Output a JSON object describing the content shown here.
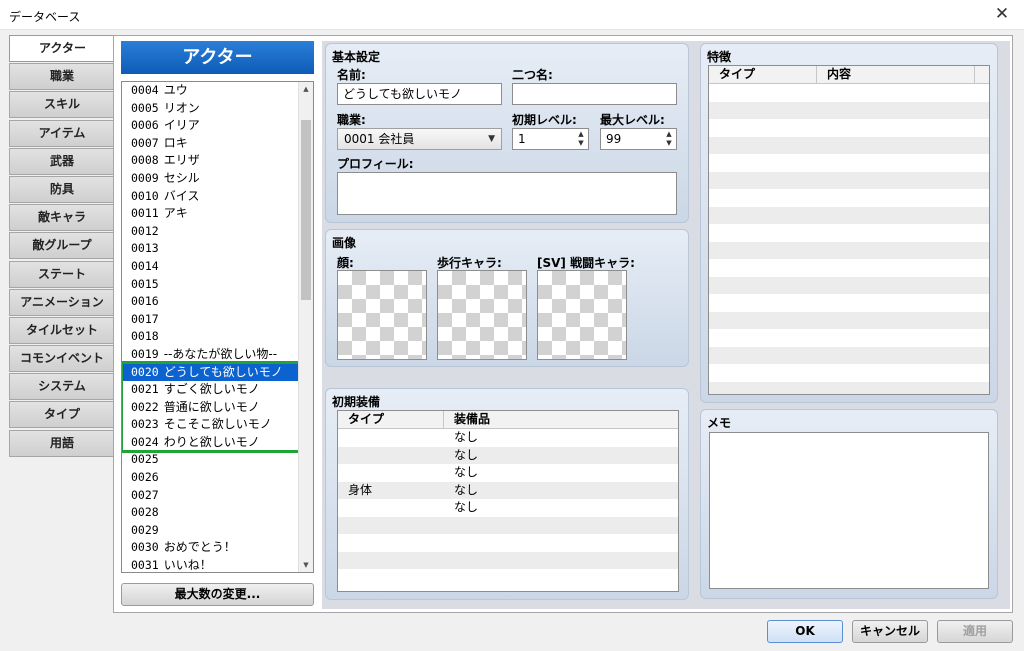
{
  "window": {
    "title": "データベース",
    "close_glyph": "✕"
  },
  "tabs": [
    {
      "label": "アクター",
      "active": true
    },
    {
      "label": "職業"
    },
    {
      "label": "スキル"
    },
    {
      "label": "アイテム"
    },
    {
      "label": "武器"
    },
    {
      "label": "防具"
    },
    {
      "label": "敵キャラ"
    },
    {
      "label": "敵グループ"
    },
    {
      "label": "ステート"
    },
    {
      "label": "アニメーション"
    },
    {
      "label": "タイルセット"
    },
    {
      "label": "コモンイベント"
    },
    {
      "label": "システム"
    },
    {
      "label": "タイプ"
    },
    {
      "label": "用語"
    }
  ],
  "actor_list": {
    "header": "アクター",
    "max_button": "最大数の変更...",
    "items": [
      {
        "num": "0004",
        "name": "ユウ"
      },
      {
        "num": "0005",
        "name": "リオン"
      },
      {
        "num": "0006",
        "name": "イリア"
      },
      {
        "num": "0007",
        "name": "ロキ"
      },
      {
        "num": "0008",
        "name": "エリザ"
      },
      {
        "num": "0009",
        "name": "セシル"
      },
      {
        "num": "0010",
        "name": "バイス"
      },
      {
        "num": "0011",
        "name": "アキ"
      },
      {
        "num": "0012",
        "name": ""
      },
      {
        "num": "0013",
        "name": ""
      },
      {
        "num": "0014",
        "name": ""
      },
      {
        "num": "0015",
        "name": ""
      },
      {
        "num": "0016",
        "name": ""
      },
      {
        "num": "0017",
        "name": ""
      },
      {
        "num": "0018",
        "name": ""
      },
      {
        "num": "0019",
        "name": "--あなたが欲しい物--"
      },
      {
        "num": "0020",
        "name": "どうしても欲しいモノ",
        "selected": true
      },
      {
        "num": "0021",
        "name": "すごく欲しいモノ"
      },
      {
        "num": "0022",
        "name": "普通に欲しいモノ"
      },
      {
        "num": "0023",
        "name": "そこそこ欲しいモノ"
      },
      {
        "num": "0024",
        "name": "わりと欲しいモノ"
      },
      {
        "num": "0025",
        "name": ""
      },
      {
        "num": "0026",
        "name": ""
      },
      {
        "num": "0027",
        "name": ""
      },
      {
        "num": "0028",
        "name": ""
      },
      {
        "num": "0029",
        "name": ""
      },
      {
        "num": "0030",
        "name": "おめでとう！"
      },
      {
        "num": "0031",
        "name": "いいね！"
      }
    ]
  },
  "basic": {
    "title": "基本設定",
    "name_label": "名前:",
    "name_value": "どうしても欲しいモノ",
    "nickname_label": "二つ名:",
    "nickname_value": "",
    "class_label": "職業:",
    "class_value": "0001 会社員",
    "init_level_label": "初期レベル:",
    "init_level_value": "1",
    "max_level_label": "最大レベル:",
    "max_level_value": "99",
    "profile_label": "プロフィール:",
    "profile_value": ""
  },
  "images": {
    "title": "画像",
    "face_label": "顔:",
    "walk_label": "歩行キャラ:",
    "battler_label": "[SV] 戦闘キャラ:"
  },
  "equipment": {
    "title": "初期装備",
    "col_type": "タイプ",
    "col_item": "装備品",
    "rows": [
      {
        "type": "",
        "item": "なし"
      },
      {
        "type": "",
        "item": "なし"
      },
      {
        "type": "",
        "item": "なし"
      },
      {
        "type": "身体",
        "item": "なし"
      },
      {
        "type": "",
        "item": "なし"
      },
      {
        "type": "",
        "item": ""
      },
      {
        "type": "",
        "item": ""
      },
      {
        "type": "",
        "item": ""
      },
      {
        "type": "",
        "item": ""
      }
    ]
  },
  "traits": {
    "title": "特徴",
    "col_type": "タイプ",
    "col_content": "内容"
  },
  "memo": {
    "title": "メモ",
    "value": ""
  },
  "buttons": {
    "ok": "OK",
    "cancel": "キャンセル",
    "apply": "適用"
  }
}
